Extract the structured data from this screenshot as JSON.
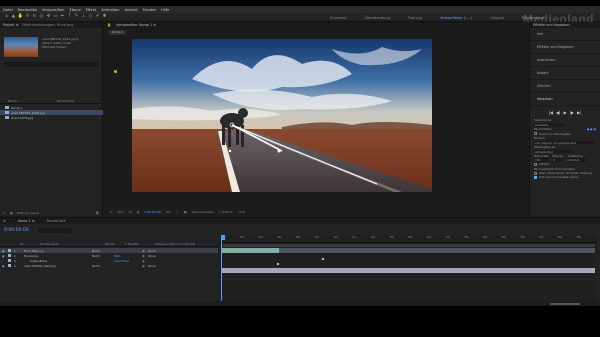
{
  "menu": [
    "Datei",
    "Bearbeiten",
    "Komposition",
    "Ebene",
    "Effekt",
    "Animation",
    "Ansicht",
    "Fenster",
    "Hilfe"
  ],
  "workspaces": [
    "Standard",
    "Überblendung",
    "Training",
    "Videoeffekte (L...)",
    "Original",
    "Bibliotheken"
  ],
  "workspace_active": "Videoeffekte (L...)",
  "watermark": "Medienland",
  "project": {
    "tab": "Projekt ≡",
    "effects_tab": "Effekteinstellungen: Hund.png",
    "footage_name": "road 380796_1920.jpg ▾",
    "footage_info": "1920 x 1280 (1,00)",
    "footage_colors": "Millionen Farben",
    "columns": [
      "Name",
      "Kommentar"
    ],
    "items": [
      {
        "name": "Komp 1",
        "color": "#8fb0d8",
        "selected": false
      },
      {
        "name": "road 380796_1920.jpg",
        "color": "#8fb0d8",
        "selected": true
      },
      {
        "name": "Hund-5678.jpg",
        "color": "#8fb0d8",
        "selected": false
      }
    ],
    "footer": "8 Bit pro Kanal"
  },
  "composition": {
    "tab": "Komposition: Komp 1 ≡",
    "subtab": "Komp 1",
    "zoom": "50%",
    "resolution": "Voll",
    "camera": "Aktive Kamera",
    "views": "1 Ansicht",
    "exposure": "+0,0"
  },
  "right": {
    "header": "Effekte und Vorgaben",
    "sections": [
      "Info",
      "Effekte und Vorgaben",
      "Ausrichten",
      "Absatz",
      "Zeichen"
    ],
    "open_section": "Vorschau",
    "preview": {
      "controls": [
        "|◀",
        "◀|",
        "▶",
        "|▶",
        "▶|"
      ],
      "shortcut_label": "Tastenkürzel",
      "shortcut_value": "Leertaste",
      "include_label": "Einschließen:",
      "cache_label": "Cache vor Wiedergabe",
      "range_label": "Bereich",
      "range_value": "Arb.-bereich um aktuelle Zeit",
      "play_label": "Wiedergabe ab",
      "play_value": "Aktuelle Zeit",
      "framerate_label": "Framerate",
      "skip_label": "Überspr.",
      "res_label": "Auflösung",
      "framerate_value": "(30)",
      "skip_value": "0",
      "res_value": "Automat.",
      "fullscreen_label": "Vollbild",
      "stop_label": "Bei (Leertaste) zum Anhalten:",
      "option1": "Wenn Zwischensp. ist bereit, Wiederg.",
      "option2": "Zeit auf Vorschauzeit setzen"
    }
  },
  "timeline": {
    "tab_comp": "Komp 1 ≡",
    "tab_render": "Renderliste",
    "timecode": "0:00:00:00",
    "columns": [
      "Nr.",
      "Quellenname",
      "Modus",
      "T  BewMas",
      "Übergeordnet und verknüpft"
    ],
    "layers": [
      {
        "num": "1",
        "name": "Form-Ebene 1",
        "mode": "Norm.",
        "parent": "Ohne",
        "selected": true,
        "color": "#8fb0d8"
      },
      {
        "num": "2",
        "name": "Hund.png",
        "mode": "Norm.",
        "parent": "Ohne",
        "selected": false,
        "color": "#8fb0d8"
      },
      {
        "num": "3",
        "name": "Ausbreitung",
        "mode": "",
        "parent": "",
        "selected": false,
        "color": "#8fb0d8"
      },
      {
        "num": "4",
        "name": "road 380796_1920.jpg",
        "mode": "Norm.",
        "parent": "Ohne",
        "selected": false,
        "color": "#8fb0d8"
      }
    ],
    "layer_value_2": "Wert",
    "layer_value_3": "0,0,0 Pixel",
    "ruler": [
      "0s",
      "02s",
      "04s",
      "06s",
      "08s",
      "10s",
      "12s",
      "14s",
      "16s",
      "18s",
      "20s",
      "22s",
      "24s",
      "26s",
      "28s",
      "30s",
      "32s",
      "34s",
      "36s",
      "38s"
    ],
    "footer": "Schalter/Modi aktivieren/deaktivieren"
  },
  "colors": {
    "accent": "#5aa0ff",
    "layer_bar_1": "#7fb2a6",
    "layer_bar_other": "#a6a6b8"
  }
}
